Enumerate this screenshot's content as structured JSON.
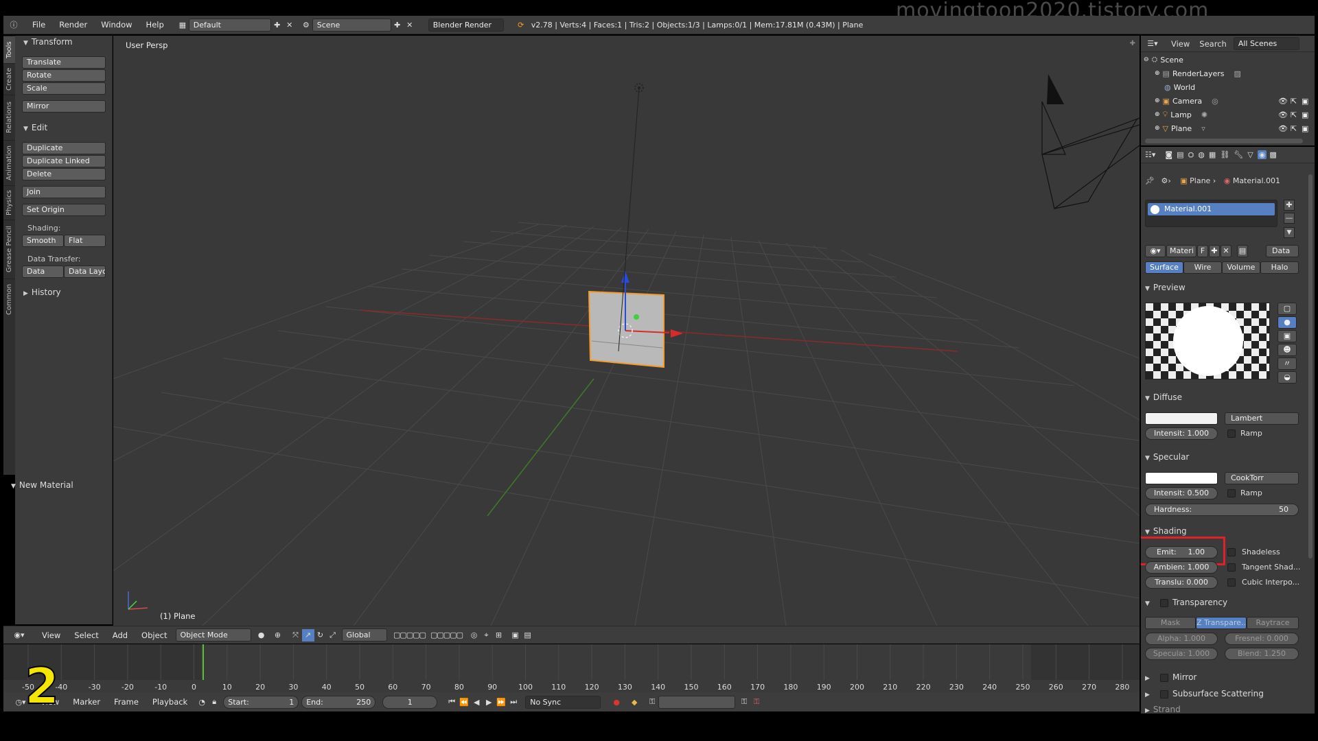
{
  "watermark": "movingtoon2020.tistory.com",
  "episode_number": "2",
  "info_header": {
    "menus": [
      "File",
      "Render",
      "Window",
      "Help"
    ],
    "layout": "Default",
    "scene": "Scene",
    "engine": "Blender Render",
    "stats": "v2.78 | Verts:4 | Faces:1 | Tris:2 | Objects:1/3 | Lamps:0/1 | Mem:17.81M (0.43M) | Plane"
  },
  "left_tabs": [
    "Tools",
    "Create",
    "Relations",
    "Animation",
    "Physics",
    "Grease Pencil",
    "Common"
  ],
  "tool_shelf": {
    "transform_title": "Transform",
    "translate": "Translate",
    "rotate": "Rotate",
    "scale": "Scale",
    "mirror": "Mirror",
    "edit_title": "Edit",
    "duplicate": "Duplicate",
    "duplicate_linked": "Duplicate Linked",
    "delete": "Delete",
    "join": "Join",
    "set_origin": "Set Origin",
    "shading_label": "Shading:",
    "smooth": "Smooth",
    "flat": "Flat",
    "data_transfer_label": "Data Transfer:",
    "data": "Data",
    "data_layout": "Data Layo",
    "history_title": "History",
    "new_material_title": "New Material"
  },
  "viewport": {
    "view_label": "User Persp",
    "object_label": "(1) Plane"
  },
  "viewport_header": {
    "menus": [
      "View",
      "Select",
      "Add",
      "Object"
    ],
    "mode": "Object Mode",
    "orientation": "Global"
  },
  "timeline": {
    "ticks": [
      "-50",
      "-40",
      "-30",
      "-20",
      "-10",
      "0",
      "10",
      "20",
      "30",
      "40",
      "50",
      "60",
      "70",
      "80",
      "90",
      "100",
      "110",
      "120",
      "130",
      "140",
      "150",
      "160",
      "170",
      "180",
      "190",
      "200",
      "210",
      "220",
      "230",
      "240",
      "250",
      "260",
      "270",
      "280"
    ],
    "current_frame": 1
  },
  "timeline_footer": {
    "menus": [
      "View",
      "Marker",
      "Frame",
      "Playback"
    ],
    "start_label": "Start:",
    "start_value": "1",
    "end_label": "End:",
    "end_value": "250",
    "current": "1",
    "sync": "No Sync"
  },
  "outliner": {
    "view": "View",
    "search": "Search",
    "filter": "All Scenes",
    "items": [
      {
        "label": "Scene",
        "icon": "scene-icon"
      },
      {
        "label": "RenderLayers",
        "icon": "renderlayers-icon"
      },
      {
        "label": "World",
        "icon": "world-icon"
      },
      {
        "label": "Camera",
        "icon": "camera-icon"
      },
      {
        "label": "Lamp",
        "icon": "lamp-icon"
      },
      {
        "label": "Plane",
        "icon": "mesh-icon"
      }
    ]
  },
  "properties": {
    "breadcrumb_object": "Plane",
    "breadcrumb_material": "Material.001",
    "material_slot": "Material.001",
    "material_name": "Materi",
    "f_label": "F",
    "data_label": "Data",
    "tabs": [
      "Surface",
      "Wire",
      "Volume",
      "Halo"
    ],
    "preview_title": "Preview",
    "diffuse_title": "Diffuse",
    "diffuse_shader": "Lambert",
    "diffuse_intensity": "Intensit: 1.000",
    "ramp": "Ramp",
    "specular_title": "Specular",
    "specular_shader": "CookTorr",
    "specular_intensity": "Intensit: 0.500",
    "hardness_label": "Hardness:",
    "hardness_value": "50",
    "shading_title": "Shading",
    "emit": "Emit:",
    "emit_value": "1.00",
    "shadeless": "Shadeless",
    "ambient": "Ambien: 1.000",
    "tangent": "Tangent Shad...",
    "translucency": "Translu: 0.000",
    "cubic": "Cubic Interpo...",
    "transparency_title": "Transparency",
    "trans_modes": [
      "Mask",
      "Z Transpare...",
      "Raytrace"
    ],
    "alpha": "Alpha: 1.000",
    "fresnel": "Fresnel: 0.000",
    "specular_t": "Specula: 1.000",
    "blend": "Blend: 1.250",
    "mirror_title": "Mirror",
    "sss_title": "Subsurface Scattering",
    "strand_title": "Strand"
  },
  "colors": {
    "highlight_box": "#e3202a",
    "selection_blue": "#5680c2",
    "selected_object": "#f39c2a"
  }
}
